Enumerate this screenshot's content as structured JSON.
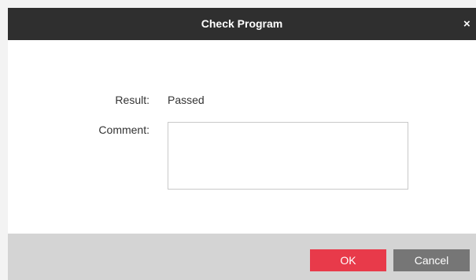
{
  "dialog": {
    "title": "Check Program",
    "close_label": "×"
  },
  "form": {
    "result_label": "Result:",
    "result_value": "Passed",
    "comment_label": "Comment:",
    "comment_value": ""
  },
  "footer": {
    "ok_label": "OK",
    "cancel_label": "Cancel"
  },
  "colors": {
    "titlebar": "#2f2f2f",
    "ok_button": "#e83a4a",
    "cancel_button": "#767676",
    "footer": "#d4d4d4"
  }
}
